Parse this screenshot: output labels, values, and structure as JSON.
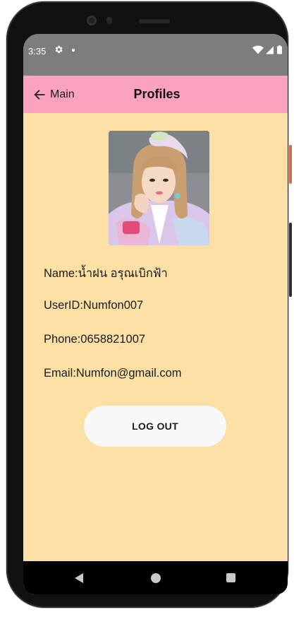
{
  "status_bar": {
    "time": "3:35",
    "icons": [
      "gear-icon",
      "dot-icon",
      "wifi-icon",
      "signal-icon",
      "battery-icon"
    ]
  },
  "app_bar": {
    "back_label": "Main",
    "title": "Profiles",
    "color": "#fba2bf"
  },
  "profile": {
    "name_label": "Name:",
    "name_value": "น้ำฝน อรุณเบิกฟ้า",
    "userid_label": "UserID:",
    "userid_value": "Numfon007",
    "phone_label": "Phone:",
    "phone_value": "0658821007",
    "email_label": "Email:",
    "email_value": "Numfon@gmail.com"
  },
  "logout_label": "LOG OUT",
  "colors": {
    "background": "#fbdfa4",
    "status_bar": "#7d7d7d",
    "button": "#f8f8f8"
  },
  "nav_bar": {
    "icons": [
      "nav-back-icon",
      "nav-home-icon",
      "nav-recents-icon"
    ]
  }
}
